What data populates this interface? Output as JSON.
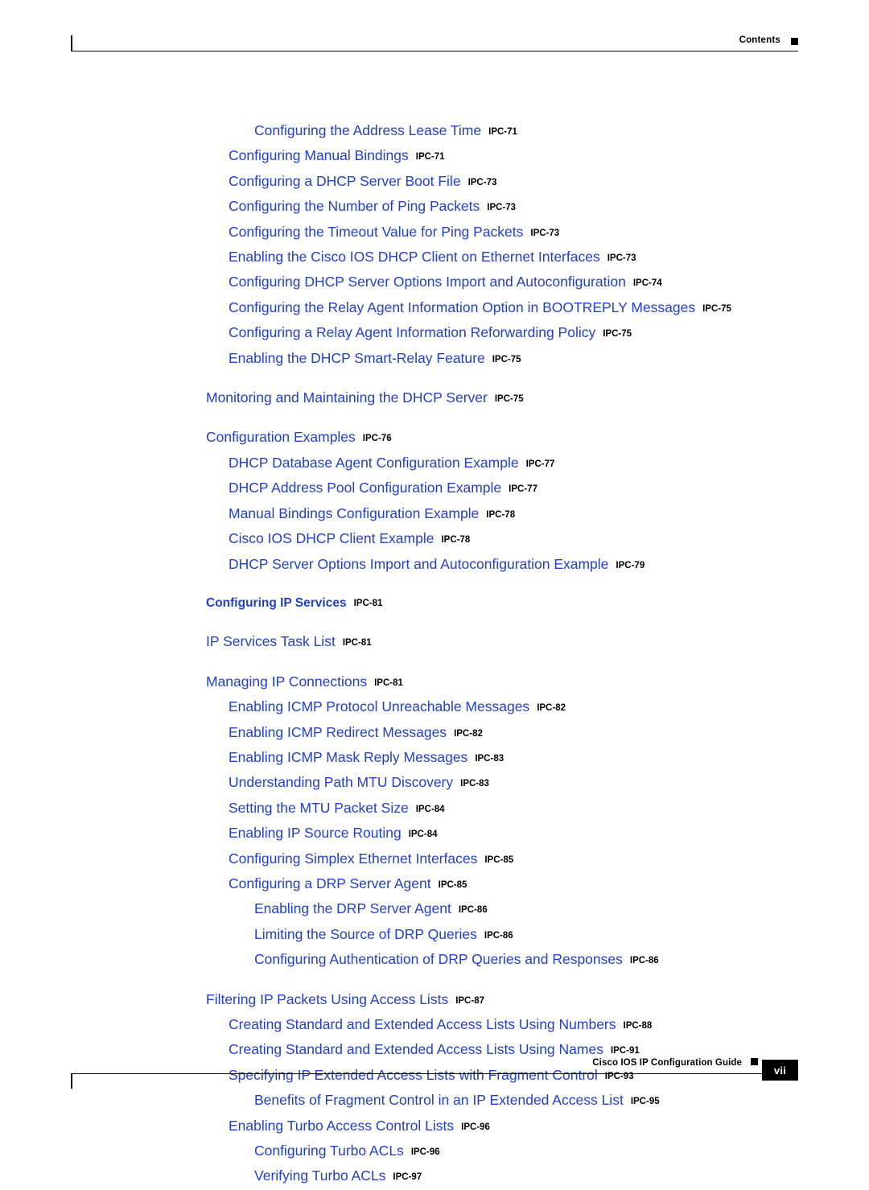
{
  "header": {
    "label": "Contents"
  },
  "footer": {
    "title": "Cisco IOS IP Configuration Guide",
    "page_number": "vii"
  },
  "toc": {
    "entries": [
      {
        "title": "Configuring the Address Lease Time",
        "page": "IPC-71",
        "level": 1
      },
      {
        "title": "Configuring Manual Bindings",
        "page": "IPC-71",
        "level": 0
      },
      {
        "title": "Configuring a DHCP Server Boot File",
        "page": "IPC-73",
        "level": 0
      },
      {
        "title": "Configuring the Number of Ping Packets",
        "page": "IPC-73",
        "level": 0
      },
      {
        "title": "Configuring the Timeout Value for Ping Packets",
        "page": "IPC-73",
        "level": 0
      },
      {
        "title": "Enabling the Cisco IOS DHCP Client on Ethernet Interfaces",
        "page": "IPC-73",
        "level": 0
      },
      {
        "title": "Configuring DHCP Server Options Import and Autoconfiguration",
        "page": "IPC-74",
        "level": 0
      },
      {
        "title": "Configuring the Relay Agent Information Option in BOOTREPLY Messages",
        "page": "IPC-75",
        "level": 0
      },
      {
        "title": "Configuring a Relay Agent Information Reforwarding Policy",
        "page": "IPC-75",
        "level": 0
      },
      {
        "title": "Enabling the DHCP Smart-Relay Feature",
        "page": "IPC-75",
        "level": 0
      },
      {
        "title": "Monitoring and Maintaining the DHCP Server",
        "page": "IPC-75",
        "level": "top"
      },
      {
        "title": "Configuration Examples",
        "page": "IPC-76",
        "level": "top"
      },
      {
        "title": "DHCP Database Agent Configuration Example",
        "page": "IPC-77",
        "level": 0
      },
      {
        "title": "DHCP Address Pool Configuration Example",
        "page": "IPC-77",
        "level": 0
      },
      {
        "title": "Manual Bindings Configuration Example",
        "page": "IPC-78",
        "level": 0
      },
      {
        "title": "Cisco IOS DHCP Client Example",
        "page": "IPC-78",
        "level": 0
      },
      {
        "title": "DHCP Server Options Import and Autoconfiguration Example",
        "page": "IPC-79",
        "level": 0
      },
      {
        "title": "Configuring IP Services",
        "page": "IPC-81",
        "level": "head"
      },
      {
        "title": "IP Services Task List",
        "page": "IPC-81",
        "level": "top"
      },
      {
        "title": "Managing IP Connections",
        "page": "IPC-81",
        "level": "top"
      },
      {
        "title": "Enabling ICMP Protocol Unreachable Messages",
        "page": "IPC-82",
        "level": 0
      },
      {
        "title": "Enabling ICMP Redirect Messages",
        "page": "IPC-82",
        "level": 0
      },
      {
        "title": "Enabling ICMP Mask Reply Messages",
        "page": "IPC-83",
        "level": 0
      },
      {
        "title": "Understanding Path MTU Discovery",
        "page": "IPC-83",
        "level": 0
      },
      {
        "title": "Setting the MTU Packet Size",
        "page": "IPC-84",
        "level": 0
      },
      {
        "title": "Enabling IP Source Routing",
        "page": "IPC-84",
        "level": 0
      },
      {
        "title": "Configuring Simplex Ethernet Interfaces",
        "page": "IPC-85",
        "level": 0
      },
      {
        "title": "Configuring a DRP Server Agent",
        "page": "IPC-85",
        "level": 0
      },
      {
        "title": "Enabling the DRP Server Agent",
        "page": "IPC-86",
        "level": 1
      },
      {
        "title": "Limiting the Source of DRP Queries",
        "page": "IPC-86",
        "level": 1
      },
      {
        "title": "Configuring Authentication of DRP Queries and Responses",
        "page": "IPC-86",
        "level": 1
      },
      {
        "title": "Filtering IP Packets Using Access Lists",
        "page": "IPC-87",
        "level": "top"
      },
      {
        "title": "Creating Standard and Extended Access Lists Using Numbers",
        "page": "IPC-88",
        "level": 0
      },
      {
        "title": "Creating Standard and Extended Access Lists Using Names",
        "page": "IPC-91",
        "level": 0
      },
      {
        "title": "Specifying IP Extended Access Lists with Fragment Control",
        "page": "IPC-93",
        "level": 0
      },
      {
        "title": "Benefits of Fragment Control in an IP Extended Access List",
        "page": "IPC-95",
        "level": 1
      },
      {
        "title": "Enabling Turbo Access Control Lists",
        "page": "IPC-96",
        "level": 0
      },
      {
        "title": "Configuring Turbo ACLs",
        "page": "IPC-96",
        "level": 1
      },
      {
        "title": "Verifying Turbo ACLs",
        "page": "IPC-97",
        "level": 1
      }
    ]
  }
}
